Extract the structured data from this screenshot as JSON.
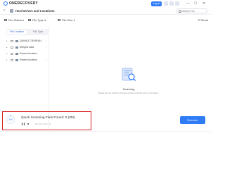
{
  "app": {
    "title": "ONERECOVERY"
  },
  "titlebar": {
    "login_label": "Log in",
    "minimize": "—",
    "maximize": "☐",
    "close": "✕"
  },
  "nav": {
    "title": "Hard Drives and Locations",
    "search_placeholder": "Search File"
  },
  "filters": [
    {
      "label": "File Status"
    },
    {
      "label": "File Type"
    },
    {
      "label": "File Size"
    }
  ],
  "reset_label": "Reset",
  "sidebar": {
    "tabs": [
      {
        "label": "File Location",
        "active": true
      },
      {
        "label": "File Type",
        "active": false
      }
    ],
    "locations": [
      {
        "label": "QUNAO CRASH(I:)"
      },
      {
        "label": "Merged data"
      },
      {
        "label": "Recent location"
      },
      {
        "label": "Recent location"
      }
    ]
  },
  "content": {
    "scan_title": "Scanning",
    "scan_subtitle": "Please do not exit the recover process until the scan is complete."
  },
  "status": {
    "progress_percent": 3,
    "progress_text": "3%",
    "files_found": "Quick Scanning Files Found: 0 (0M)",
    "remaining": "Remain Time: 4s"
  },
  "actions": {
    "recover_label": "Recover"
  },
  "colors": {
    "accent": "#2f7cf6",
    "highlight": "#d6201f"
  }
}
